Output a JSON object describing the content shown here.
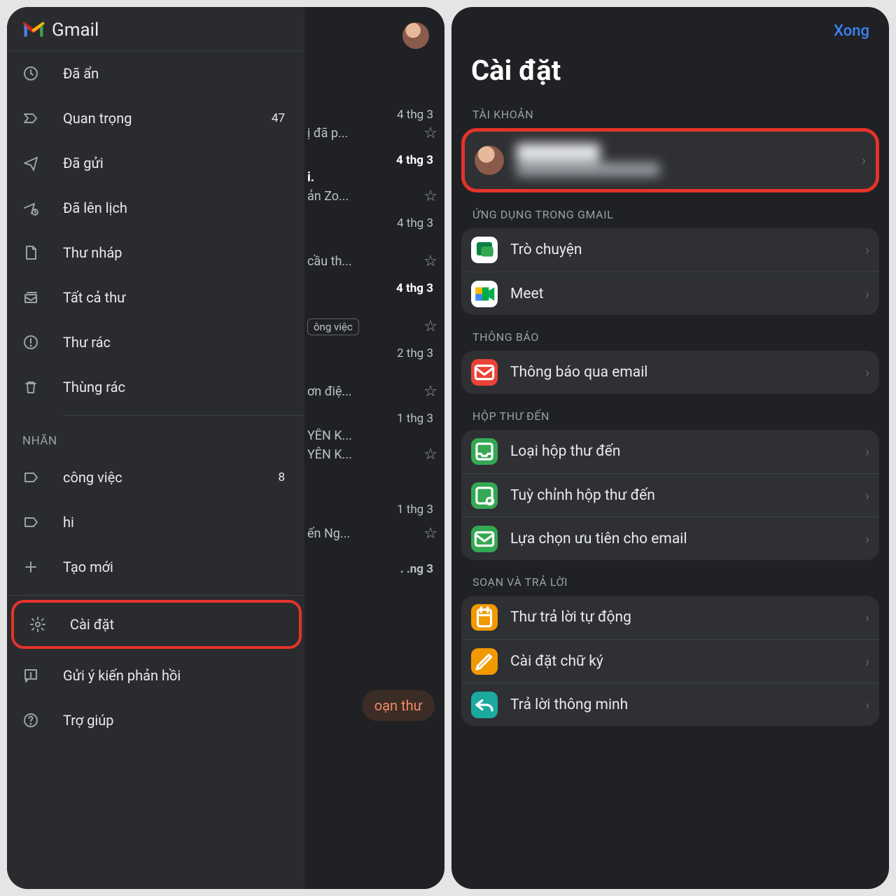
{
  "left": {
    "app_name": "Gmail",
    "nav_items": [
      {
        "label": "Đã ẩn",
        "count": ""
      },
      {
        "label": "Quan trọng",
        "count": "47"
      },
      {
        "label": "Đã gửi",
        "count": ""
      },
      {
        "label": "Đã lên lịch",
        "count": ""
      },
      {
        "label": "Thư nháp",
        "count": ""
      },
      {
        "label": "Tất cả thư",
        "count": ""
      },
      {
        "label": "Thư rác",
        "count": ""
      },
      {
        "label": "Thùng rác",
        "count": ""
      }
    ],
    "section_labels": "NHÃN",
    "labels": [
      {
        "label": "công việc",
        "count": "8"
      },
      {
        "label": "hi",
        "count": ""
      }
    ],
    "create_new": "Tạo mới",
    "bottom": [
      {
        "label": "Cài đặt"
      },
      {
        "label": "Gửi ý kiến phản hồi"
      },
      {
        "label": "Trợ giúp"
      }
    ],
    "behind": {
      "rows": [
        {
          "date": "4 thg 3",
          "snip": "ị đã p...",
          "bold": false
        },
        {
          "date": "4 thg 3",
          "snip": "i.",
          "snip2": "ản Zo...",
          "bold": true
        },
        {
          "date": "4 thg 3",
          "snip": "cầu th...",
          "bold": false
        },
        {
          "date": "4 thg 3",
          "snip": "",
          "chip": "ông việc",
          "bold": true
        },
        {
          "date": "2 thg 3",
          "snip": "ơn điệ...",
          "bold": false
        },
        {
          "date": "1 thg 3",
          "snip": "YÊN K...",
          "snip2": "YÊN K...",
          "bold": false
        },
        {
          "date": "1 thg 3",
          "snip": "ến Ng...",
          "bold": false
        },
        {
          "date": ". .ng 3",
          "snip": "",
          "bold": false
        }
      ],
      "compose": "oạn thư"
    }
  },
  "right": {
    "done": "Xong",
    "title": "Cài đặt",
    "sections": {
      "account": "TÀI KHOẢN",
      "apps": "ỨNG DỤNG TRONG GMAIL",
      "notif": "THÔNG BÁO",
      "inbox": "HỘP THƯ ĐẾN",
      "compose": "SOẠN VÀ TRẢ LỜI"
    },
    "account_name": "████████",
    "account_email": "██████████████████",
    "apps": [
      {
        "label": "Trò chuyện"
      },
      {
        "label": "Meet"
      }
    ],
    "notif_item": "Thông báo qua email",
    "inbox_items": [
      {
        "label": "Loại hộp thư đến"
      },
      {
        "label": "Tuỳ chỉnh hộp thư đến"
      },
      {
        "label": "Lựa chọn ưu tiên cho email"
      }
    ],
    "compose_items": [
      {
        "label": "Thư trả lời tự động"
      },
      {
        "label": "Cài đặt chữ ký"
      },
      {
        "label": "Trả lời thông minh"
      }
    ]
  }
}
